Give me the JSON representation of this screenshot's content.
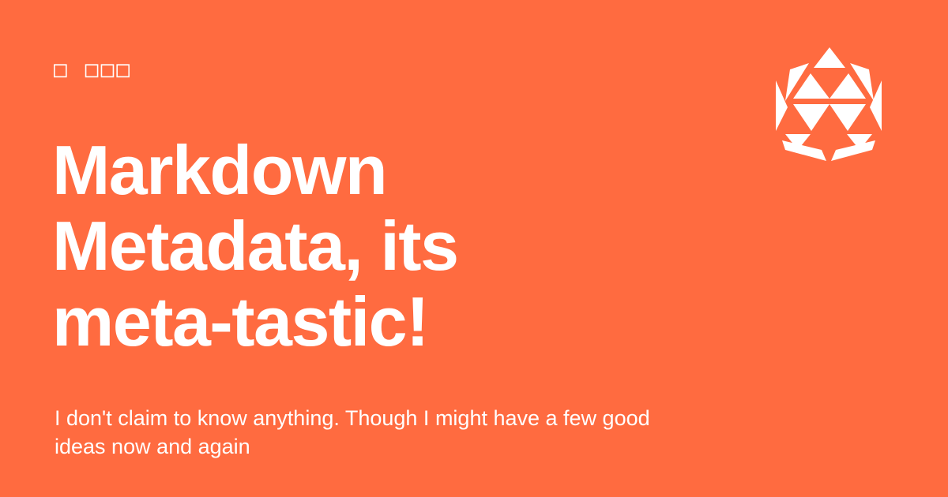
{
  "page": {
    "eyebrow": "□ □□□",
    "title": "Markdown Metadata, its meta-tastic!",
    "description": "I don't claim to know anything. Though I might have a few good ideas now and again"
  },
  "logo": {
    "icon": "geodesic-polyhedron-icon",
    "color": "#ffffff"
  },
  "colors": {
    "background": "#ff6b40",
    "text": "#ffffff"
  }
}
